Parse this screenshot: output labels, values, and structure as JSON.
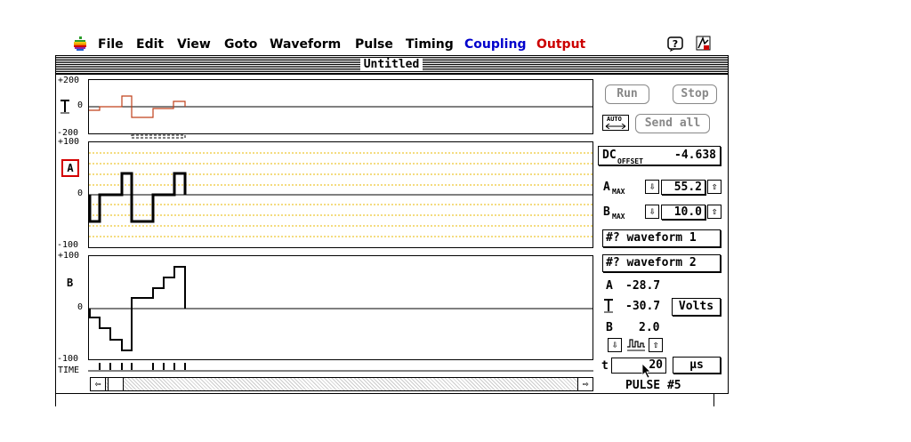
{
  "menubar": {
    "items": [
      {
        "label": "File",
        "color": "#000000"
      },
      {
        "label": "Edit",
        "color": "#000000"
      },
      {
        "label": "View",
        "color": "#000000"
      },
      {
        "label": "Goto",
        "color": "#000000"
      },
      {
        "label": "Waveform",
        "color": "#000000"
      },
      {
        "label": "Pulse",
        "color": "#000000"
      },
      {
        "label": "Timing",
        "color": "#000000"
      },
      {
        "label": "Coupling",
        "color": "#0000cc"
      },
      {
        "label": "Output",
        "color": "#cc0000"
      }
    ],
    "icons": [
      "apple-logo-icon",
      "help-icon",
      "app-icon"
    ]
  },
  "window": {
    "title": "Untitled"
  },
  "plots": {
    "top": {
      "ymax": "+200",
      "ymid": "0",
      "ymin": "-200"
    },
    "a": {
      "ymax": "+100",
      "ymid": "0",
      "ymin": "-100",
      "channel": "A"
    },
    "b": {
      "ymax": "+100",
      "ymid": "0",
      "ymin": "-100",
      "channel": "B"
    },
    "time_label": "TIME"
  },
  "controls": {
    "run": "Run",
    "stop": "Stop",
    "auto": "AUTO",
    "send_all": "Send all",
    "dc_offset_label": "DC",
    "dc_offset_sub": "OFFSET",
    "dc_offset_value": "-4.638",
    "amax_label": "A",
    "amax_sub": "MAX",
    "amax_value": "55.2",
    "bmax_label": "B",
    "bmax_sub": "MAX",
    "bmax_value": "10.0",
    "waveform1": "#? waveform 1",
    "waveform2": "#? waveform 2",
    "a_readout_label": "A",
    "a_readout_value": "-28.7",
    "mid_readout_value": "-30.7",
    "volts": "Volts",
    "b_readout_label": "B",
    "b_readout_value": "2.0",
    "t_label": "t",
    "t_value": "20",
    "t_unit": "µs",
    "pulse": "PULSE #5"
  }
}
